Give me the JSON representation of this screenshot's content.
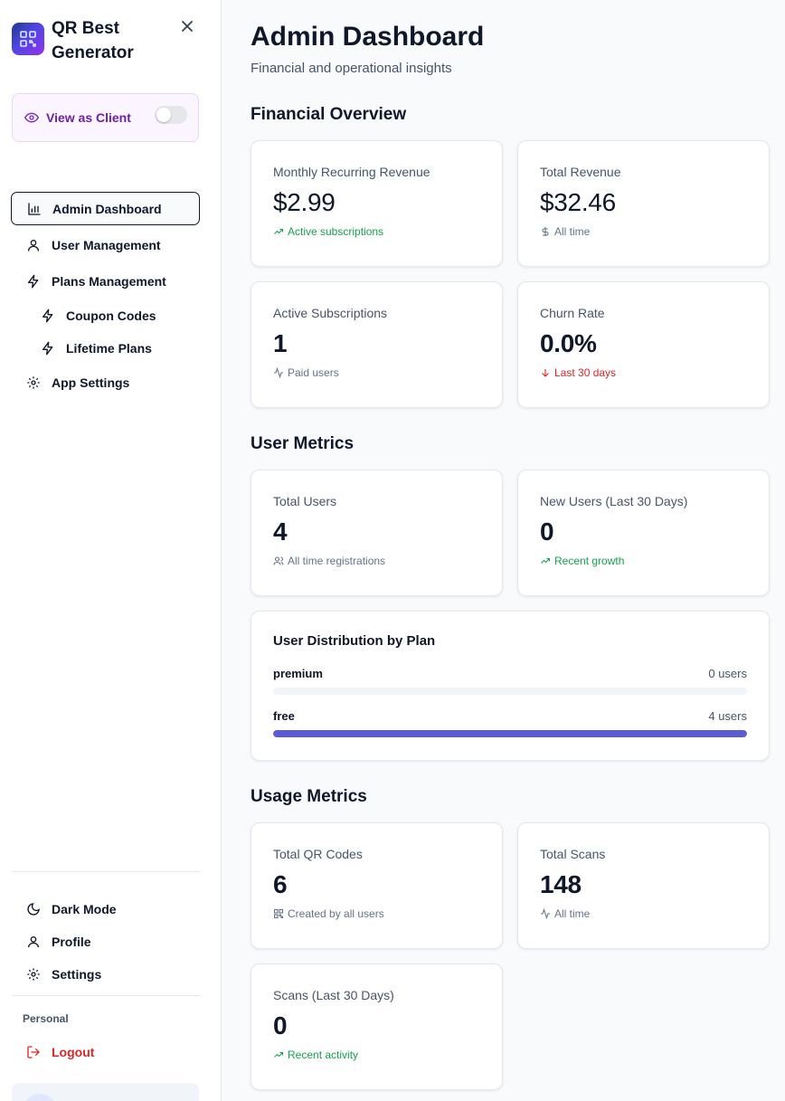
{
  "app": {
    "name": "QR Best Generator",
    "view_as_client": "View as Client"
  },
  "nav": {
    "items": [
      {
        "label": "Admin Dashboard"
      },
      {
        "label": "User Management"
      },
      {
        "label": "Plans Management"
      },
      {
        "label": "Coupon Codes"
      },
      {
        "label": "Lifetime Plans"
      },
      {
        "label": "App Settings"
      }
    ],
    "bottom": [
      {
        "label": "Dark Mode"
      },
      {
        "label": "Profile"
      },
      {
        "label": "Settings"
      }
    ],
    "section_label": "Personal",
    "logout": "Logout"
  },
  "page": {
    "title": "Admin Dashboard",
    "subtitle": "Financial and operational insights"
  },
  "financial": {
    "heading": "Financial Overview",
    "mrr": {
      "title": "Monthly Recurring Revenue",
      "value": "$2.99",
      "note": "Active subscriptions"
    },
    "revenue": {
      "title": "Total Revenue",
      "value": "$32.46",
      "note": "All time"
    },
    "active": {
      "title": "Active Subscriptions",
      "value": "1",
      "note": "Paid users"
    },
    "churn": {
      "title": "Churn Rate",
      "value": "0.0%",
      "note": "Last 30 days"
    }
  },
  "users": {
    "heading": "User Metrics",
    "total": {
      "title": "Total Users",
      "value": "4",
      "note": "All time registrations"
    },
    "new": {
      "title": "New Users (Last 30 Days)",
      "value": "0",
      "note": "Recent growth"
    },
    "distribution": {
      "title": "User Distribution by Plan",
      "plans": [
        {
          "name": "premium",
          "count": "0 users",
          "fraction": 0.0
        },
        {
          "name": "free",
          "count": "4 users",
          "fraction": 1.0
        }
      ]
    }
  },
  "usage": {
    "heading": "Usage Metrics",
    "qr": {
      "title": "Total QR Codes",
      "value": "6",
      "note": "Created by all users"
    },
    "scans": {
      "title": "Total Scans",
      "value": "148",
      "note": "All time"
    },
    "recent": {
      "title": "Scans (Last 30 Days)",
      "value": "0",
      "note": "Recent activity"
    }
  },
  "colors": {
    "accent": "#5b5bd6",
    "positive": "#16a34a",
    "negative": "#dc2626",
    "client_toggle": "#6b21a8"
  }
}
